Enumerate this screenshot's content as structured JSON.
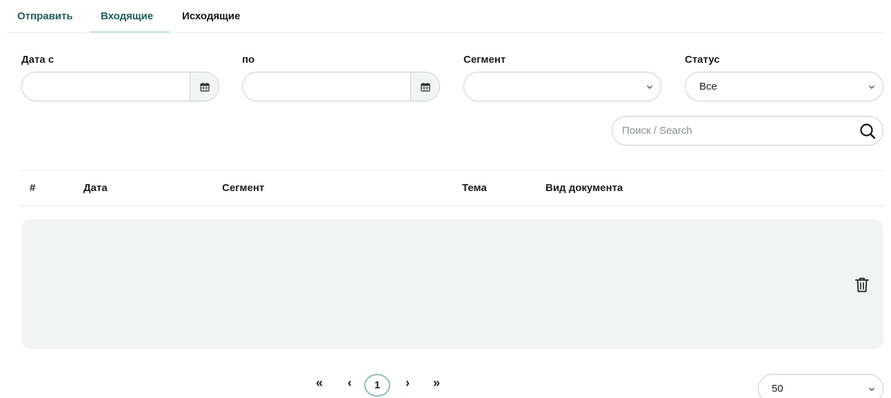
{
  "tabs": {
    "send": "Отправить",
    "incoming": "Входящие",
    "outgoing": "Исходящие"
  },
  "filters": {
    "date_from_label": "Дата с",
    "date_to_label": "по",
    "segment_label": "Сегмент",
    "status_label": "Статус",
    "date_from_value": "",
    "date_to_value": "",
    "segment_value": "",
    "status_value": "Все"
  },
  "search": {
    "placeholder": "Поиск / Search",
    "value": ""
  },
  "table": {
    "columns": [
      "#",
      "Дата",
      "Сегмент",
      "Тема",
      "Вид документа"
    ]
  },
  "pagination": {
    "first": "«",
    "prev": "‹",
    "current_page": "1",
    "next": "›",
    "last": "»",
    "per_page": "50"
  },
  "icons": {
    "calendar": "calendar-icon",
    "chevron": "chevron-down-icon",
    "search": "search-icon",
    "trash": "trash-icon"
  },
  "colors": {
    "accent": "#1e5c58",
    "tab_underline": "#cfe4e2",
    "page_ring": "#8fbdb8",
    "row_bg": "#f2f4f4"
  }
}
